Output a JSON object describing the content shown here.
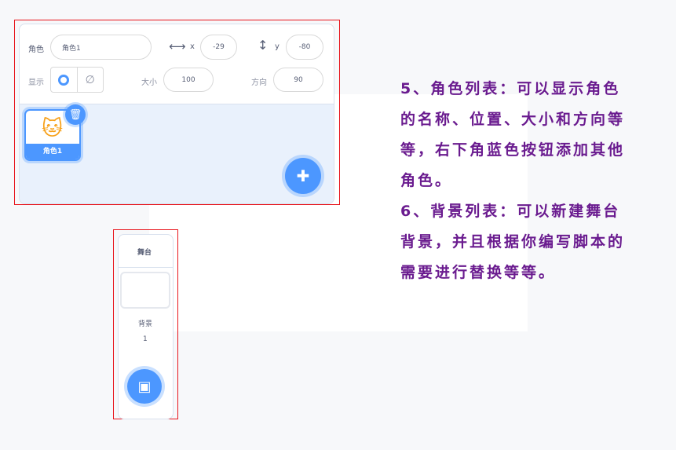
{
  "sprite_info": {
    "sprite_label": "角色",
    "sprite_name": "角色1",
    "x_label": "x",
    "x_value": "-29",
    "y_label": "y",
    "y_value": "-80",
    "show_label": "显示",
    "size_label": "大小",
    "size_value": "100",
    "direction_label": "方向",
    "direction_value": "90"
  },
  "sprite_list": {
    "items": [
      {
        "name": "角色1"
      }
    ]
  },
  "stage": {
    "title": "舞台",
    "backdrops_label": "背景",
    "backdrop_count": "1"
  },
  "colors": {
    "accent": "#4c97ff",
    "text": "#6a1b8f",
    "frame": "#e8141b"
  },
  "notes": {
    "lines": [
      "5、角色列表：可以显示角色",
      "的名称、位置、大小和方向等",
      "等，右下角蓝色按钮添加其他",
      "角色。",
      "6、背景列表：可以新建舞台",
      "背景，并且根据你编写脚本的",
      "需要进行替换等等。"
    ]
  }
}
